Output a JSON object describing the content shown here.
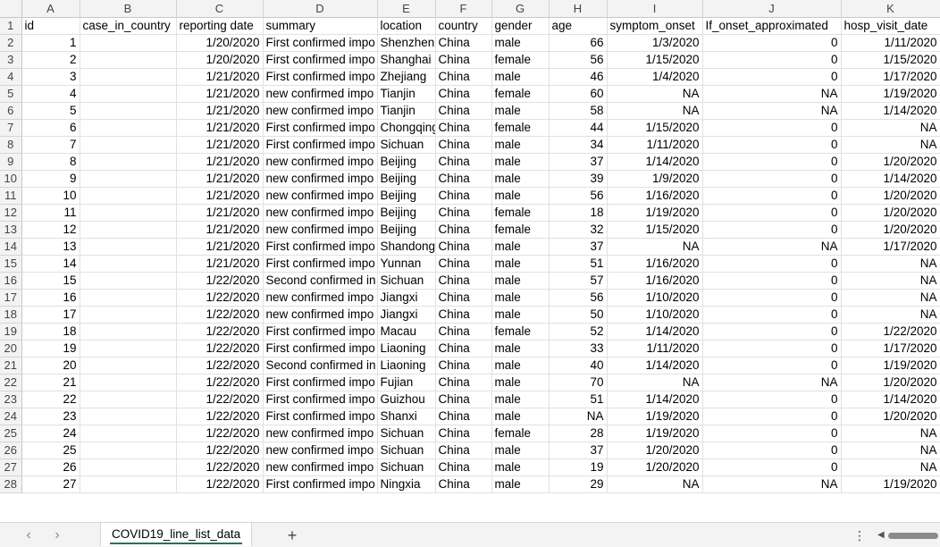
{
  "columns": [
    "A",
    "B",
    "C",
    "D",
    "E",
    "F",
    "G",
    "H",
    "I",
    "J",
    "K"
  ],
  "header_row": {
    "num": "1",
    "cells": [
      "id",
      "case_in_country",
      "reporting date",
      "summary",
      "location",
      "country",
      "gender",
      "age",
      "symptom_onset",
      "If_onset_approximated",
      "hosp_visit_date"
    ]
  },
  "rows": [
    {
      "num": "2",
      "cells": [
        "1",
        "",
        "1/20/2020",
        "First confirmed impo",
        "Shenzhen",
        "China",
        "male",
        "66",
        "1/3/2020",
        "0",
        "1/11/2020"
      ]
    },
    {
      "num": "3",
      "cells": [
        "2",
        "",
        "1/20/2020",
        "First confirmed impo",
        "Shanghai",
        "China",
        "female",
        "56",
        "1/15/2020",
        "0",
        "1/15/2020"
      ]
    },
    {
      "num": "4",
      "cells": [
        "3",
        "",
        "1/21/2020",
        "First confirmed impo",
        "Zhejiang",
        "China",
        "male",
        "46",
        "1/4/2020",
        "0",
        "1/17/2020"
      ]
    },
    {
      "num": "5",
      "cells": [
        "4",
        "",
        "1/21/2020",
        "new confirmed impo",
        "Tianjin",
        "China",
        "female",
        "60",
        "NA",
        "NA",
        "1/19/2020"
      ]
    },
    {
      "num": "6",
      "cells": [
        "5",
        "",
        "1/21/2020",
        "new confirmed impo",
        "Tianjin",
        "China",
        "male",
        "58",
        "NA",
        "NA",
        "1/14/2020"
      ]
    },
    {
      "num": "7",
      "cells": [
        "6",
        "",
        "1/21/2020",
        "First confirmed impo",
        "Chongqing",
        "China",
        "female",
        "44",
        "1/15/2020",
        "0",
        "NA"
      ]
    },
    {
      "num": "8",
      "cells": [
        "7",
        "",
        "1/21/2020",
        "First confirmed impo",
        "Sichuan",
        "China",
        "male",
        "34",
        "1/11/2020",
        "0",
        "NA"
      ]
    },
    {
      "num": "9",
      "cells": [
        "8",
        "",
        "1/21/2020",
        "new confirmed impo",
        "Beijing",
        "China",
        "male",
        "37",
        "1/14/2020",
        "0",
        "1/20/2020"
      ]
    },
    {
      "num": "10",
      "cells": [
        "9",
        "",
        "1/21/2020",
        "new confirmed impo",
        "Beijing",
        "China",
        "male",
        "39",
        "1/9/2020",
        "0",
        "1/14/2020"
      ]
    },
    {
      "num": "11",
      "cells": [
        "10",
        "",
        "1/21/2020",
        "new confirmed impo",
        "Beijing",
        "China",
        "male",
        "56",
        "1/16/2020",
        "0",
        "1/20/2020"
      ]
    },
    {
      "num": "12",
      "cells": [
        "11",
        "",
        "1/21/2020",
        "new confirmed impo",
        "Beijing",
        "China",
        "female",
        "18",
        "1/19/2020",
        "0",
        "1/20/2020"
      ]
    },
    {
      "num": "13",
      "cells": [
        "12",
        "",
        "1/21/2020",
        "new confirmed impo",
        "Beijing",
        "China",
        "female",
        "32",
        "1/15/2020",
        "0",
        "1/20/2020"
      ]
    },
    {
      "num": "14",
      "cells": [
        "13",
        "",
        "1/21/2020",
        "First confirmed impo",
        "Shandong",
        "China",
        "male",
        "37",
        "NA",
        "NA",
        "1/17/2020"
      ]
    },
    {
      "num": "15",
      "cells": [
        "14",
        "",
        "1/21/2020",
        "First confirmed impo",
        "Yunnan",
        "China",
        "male",
        "51",
        "1/16/2020",
        "0",
        "NA"
      ]
    },
    {
      "num": "16",
      "cells": [
        "15",
        "",
        "1/22/2020",
        "Second confirmed in",
        "Sichuan",
        "China",
        "male",
        "57",
        "1/16/2020",
        "0",
        "NA"
      ]
    },
    {
      "num": "17",
      "cells": [
        "16",
        "",
        "1/22/2020",
        "new confirmed impo",
        "Jiangxi",
        "China",
        "male",
        "56",
        "1/10/2020",
        "0",
        "NA"
      ]
    },
    {
      "num": "18",
      "cells": [
        "17",
        "",
        "1/22/2020",
        "new confirmed impo",
        "Jiangxi",
        "China",
        "male",
        "50",
        "1/10/2020",
        "0",
        "NA"
      ]
    },
    {
      "num": "19",
      "cells": [
        "18",
        "",
        "1/22/2020",
        "First confirmed impo",
        "Macau",
        "China",
        "female",
        "52",
        "1/14/2020",
        "0",
        "1/22/2020"
      ]
    },
    {
      "num": "20",
      "cells": [
        "19",
        "",
        "1/22/2020",
        "First confirmed impo",
        "Liaoning",
        "China",
        "male",
        "33",
        "1/11/2020",
        "0",
        "1/17/2020"
      ]
    },
    {
      "num": "21",
      "cells": [
        "20",
        "",
        "1/22/2020",
        "Second confirmed in",
        "Liaoning",
        "China",
        "male",
        "40",
        "1/14/2020",
        "0",
        "1/19/2020"
      ]
    },
    {
      "num": "22",
      "cells": [
        "21",
        "",
        "1/22/2020",
        "First confirmed impo",
        "Fujian",
        "China",
        "male",
        "70",
        "NA",
        "NA",
        "1/20/2020"
      ]
    },
    {
      "num": "23",
      "cells": [
        "22",
        "",
        "1/22/2020",
        "First confirmed impo",
        "Guizhou",
        "China",
        "male",
        "51",
        "1/14/2020",
        "0",
        "1/14/2020"
      ]
    },
    {
      "num": "24",
      "cells": [
        "23",
        "",
        "1/22/2020",
        "First confirmed impo",
        "Shanxi",
        "China",
        "male",
        "NA",
        "1/19/2020",
        "0",
        "1/20/2020"
      ]
    },
    {
      "num": "25",
      "cells": [
        "24",
        "",
        "1/22/2020",
        "new confirmed impo",
        "Sichuan",
        "China",
        "female",
        "28",
        "1/19/2020",
        "0",
        "NA"
      ]
    },
    {
      "num": "26",
      "cells": [
        "25",
        "",
        "1/22/2020",
        "new confirmed impo",
        "Sichuan",
        "China",
        "male",
        "37",
        "1/20/2020",
        "0",
        "NA"
      ]
    },
    {
      "num": "27",
      "cells": [
        "26",
        "",
        "1/22/2020",
        "new confirmed impo",
        "Sichuan",
        "China",
        "male",
        "19",
        "1/20/2020",
        "0",
        "NA"
      ]
    },
    {
      "num": "28",
      "cells": [
        "27",
        "",
        "1/22/2020",
        "First confirmed impo",
        "Ningxia",
        "China",
        "male",
        "29",
        "NA",
        "NA",
        "1/19/2020"
      ]
    }
  ],
  "sheet_tab": {
    "label": "COVID19_line_list_data"
  },
  "bottom": {
    "prev_icon": "chevron-left-icon",
    "next_icon": "chevron-right-icon",
    "add_icon": "plus-icon",
    "more_icon": "vertical-ellipsis-icon"
  },
  "colors": {
    "accent": "#1d7a45",
    "header_bg": "#f3f3f3",
    "gridline": "#e1e1e1"
  }
}
